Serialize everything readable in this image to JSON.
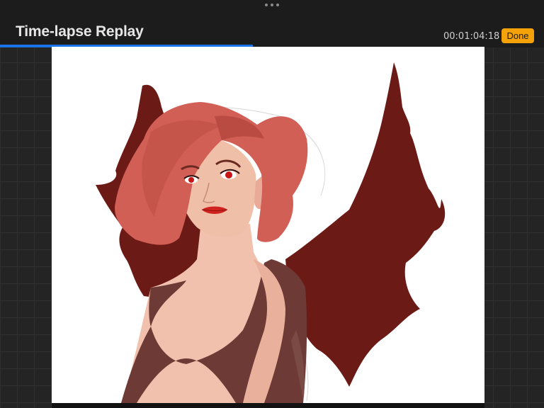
{
  "header": {
    "title": "Time-lapse Replay",
    "timecode": "00:01:04:18",
    "done_label": "Done"
  },
  "playback": {
    "progress_fraction": 0.465
  },
  "colors": {
    "accent": "#f5a208",
    "progress": "#1a73e8",
    "background": "#262626"
  },
  "icons": {
    "grabber": "more-dots-icon"
  }
}
